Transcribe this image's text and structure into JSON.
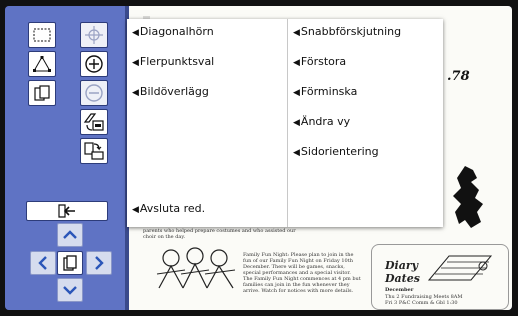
{
  "menu": {
    "left": [
      "Diagonalhörn",
      "Flerpunktsval",
      "Bildöverlägg"
    ],
    "right": [
      "Snabbförskjutning",
      "Förstora",
      "Förminska",
      "Ändra vy",
      "Sidorientering"
    ],
    "bottom": "Avsluta red."
  },
  "arrow_glyph": "◀",
  "document": {
    "number_fragment": ".78",
    "community_text": "excellent leadership of our choir. Many thanks also to the parents who helped prepare costumes and who assisted our choir on the day.",
    "family_fun_night": "Family Fun Night: Please plan to join in the fun of our Family Fun Night on Friday 10th December. There will be games, snacks, special performances and a special visitor. The Family Fun Night commences at 4 pm but families can join in the fun whenever they arrive. Watch for notices with more details.",
    "diary_title_1": "Diary",
    "diary_title_2": "Dates",
    "diary_month": "December",
    "diary_entry_1": "Thu 2 Fundraising Meets 8AM",
    "diary_entry_2": "Fri 3 P&C Comm & Gbl 1:30"
  }
}
